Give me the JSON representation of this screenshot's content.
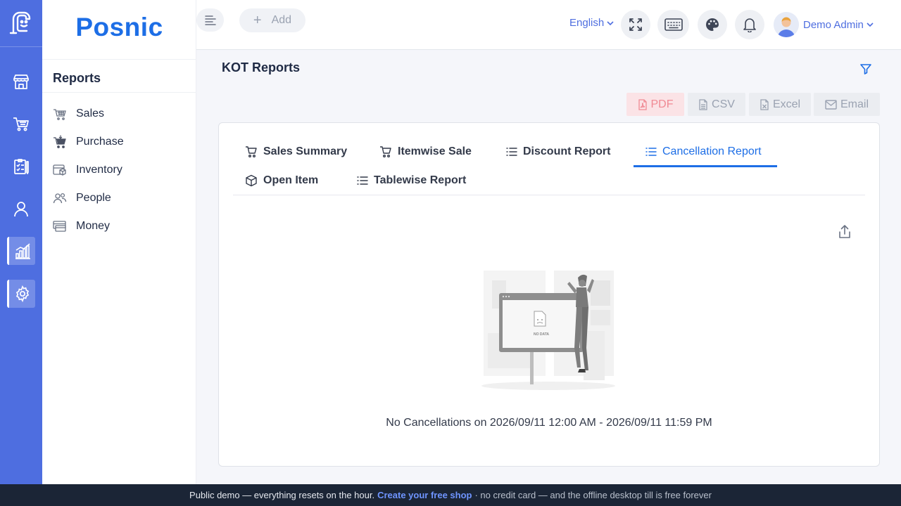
{
  "brand": {
    "name": "Posnic"
  },
  "rail": {
    "items": [
      {
        "icon": "store-icon"
      },
      {
        "icon": "cart-icon"
      },
      {
        "icon": "clipboard-icon"
      },
      {
        "icon": "user-icon"
      },
      {
        "icon": "chart-icon",
        "active": true
      },
      {
        "icon": "gear-icon",
        "active": true
      }
    ]
  },
  "sidebar": {
    "title": "Reports",
    "items": [
      {
        "label": "Sales",
        "icon": "basket-icon"
      },
      {
        "label": "Purchase",
        "icon": "purchase-cart-icon"
      },
      {
        "label": "Inventory",
        "icon": "inventory-icon"
      },
      {
        "label": "People",
        "icon": "people-icon"
      },
      {
        "label": "Money",
        "icon": "money-icon"
      }
    ]
  },
  "header": {
    "add_label": "Add",
    "language": "English",
    "user_name": "Demo Admin"
  },
  "main": {
    "title": "KOT Reports",
    "export": {
      "pdf": "PDF",
      "csv": "CSV",
      "excel": "Excel",
      "email": "Email"
    },
    "tabs": [
      {
        "label": "Sales Summary",
        "icon": "cart-icon"
      },
      {
        "label": "Itemwise Sale",
        "icon": "cart-icon"
      },
      {
        "label": "Discount Report",
        "icon": "list-icon"
      },
      {
        "label": "Cancellation Report",
        "icon": "list-icon",
        "active": true
      },
      {
        "label": "Open Item",
        "icon": "box-icon"
      },
      {
        "label": "Tablewise Report",
        "icon": "list-icon"
      }
    ],
    "illustration_text": "NO DATA",
    "empty_message": "No Cancellations on 2026/09/11 12:00 AM - 2026/09/11 11:59 PM"
  },
  "footer": {
    "prefix": "Public demo — everything resets on the hour.",
    "link": "Create your free shop",
    "suffix": "· no credit card — and the offline desktop till is free forever"
  },
  "colors": {
    "rail": "#4e6ee0",
    "accent": "#1d6ee6",
    "footer": "#1b2536"
  }
}
